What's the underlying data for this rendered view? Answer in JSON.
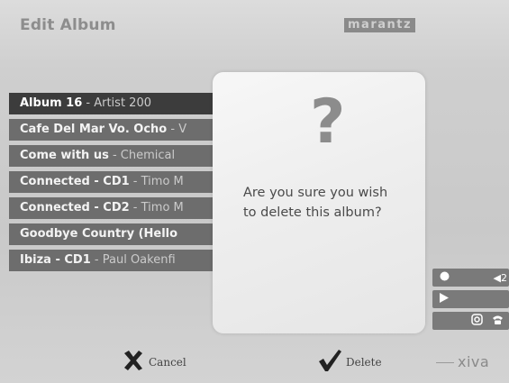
{
  "header": {
    "title": "Edit Album"
  },
  "brand": {
    "logo_text": "marantz",
    "footer_logo_text": "xiva"
  },
  "albums": [
    {
      "title": "Album 16",
      "separator": " - ",
      "artist": "Artist 200",
      "selected": true
    },
    {
      "title": "Cafe Del Mar Vo. Ocho",
      "separator": " - ",
      "artist": "V",
      "selected": false
    },
    {
      "title": "Come with us",
      "separator": " - ",
      "artist": "Chemical",
      "selected": false
    },
    {
      "title": "Connected - CD1",
      "separator": " - ",
      "artist": "Timo M",
      "selected": false
    },
    {
      "title": "Connected - CD2",
      "separator": " - ",
      "artist": "Timo M",
      "selected": false
    },
    {
      "title": "Goodbye Country (Hello",
      "separator": "",
      "artist": "",
      "selected": false
    },
    {
      "title": "Ibiza - CD1",
      "separator": " - ",
      "artist": "Paul Oakenfi",
      "selected": false
    }
  ],
  "dialog": {
    "glyph": "?",
    "message": "Are you sure you wish to delete this album?"
  },
  "footer": {
    "cancel_label": "Cancel",
    "delete_label": "Delete"
  },
  "side_controls": {
    "volume_text": "◀2"
  },
  "colors": {
    "selected_row": "#3c3c3c",
    "row": "#6d6d6d",
    "dialog_bg": "#eeeeee"
  }
}
